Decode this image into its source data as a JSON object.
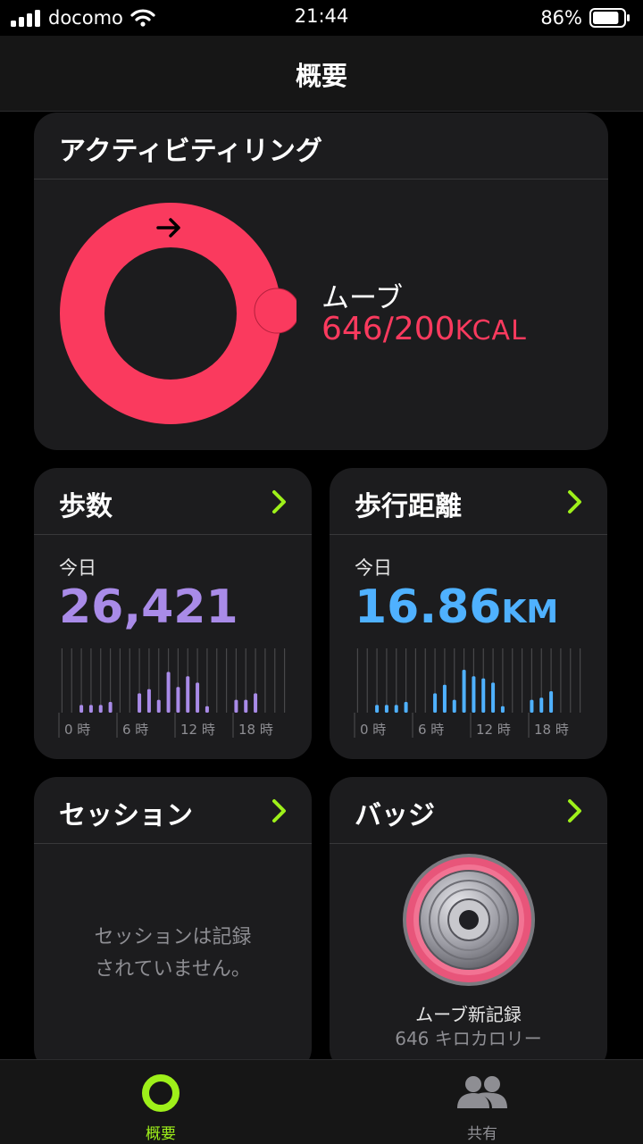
{
  "status_bar": {
    "carrier": "docomo",
    "time": "21:44",
    "battery": "86%",
    "battery_level": 0.86
  },
  "nav": {
    "title": "概要"
  },
  "activity_ring": {
    "title": "アクティビティリング",
    "label": "ムーブ",
    "value": "646/200",
    "unit": "KCAL",
    "progress": 3.23,
    "color": "#fa3a5e"
  },
  "steps": {
    "title": "歩数",
    "today_label": "今日",
    "value": "26,421",
    "unit": "",
    "color": "#a98be8",
    "hour_labels": [
      "0 時",
      "6 時",
      "12 時",
      "18 時"
    ],
    "hourly": [
      0,
      0,
      0.18,
      0.18,
      0.18,
      0.25,
      0,
      0,
      0.45,
      0.55,
      0.3,
      0.95,
      0.6,
      0.85,
      0.7,
      0.15,
      0,
      0,
      0.3,
      0.3,
      0.45,
      0,
      0,
      0
    ]
  },
  "distance": {
    "title": "歩行距離",
    "today_label": "今日",
    "value": "16.86",
    "unit": "KM",
    "color": "#4fb1ff",
    "hour_labels": [
      "0 時",
      "6 時",
      "12 時",
      "18 時"
    ],
    "hourly": [
      0,
      0,
      0.18,
      0.18,
      0.18,
      0.25,
      0,
      0,
      0.45,
      0.65,
      0.3,
      1.0,
      0.85,
      0.8,
      0.7,
      0.15,
      0,
      0,
      0.3,
      0.35,
      0.5,
      0,
      0,
      0
    ]
  },
  "sessions": {
    "title": "セッション",
    "empty_line1": "セッションは記録",
    "empty_line2": "されていません。"
  },
  "badges": {
    "title": "バッジ",
    "badge_name": "ムーブ新記録",
    "badge_detail": "646 キロカロリー"
  },
  "tabs": [
    {
      "label": "概要",
      "icon": "activity-ring-icon",
      "active": true
    },
    {
      "label": "共有",
      "icon": "people-icon",
      "active": false
    }
  ],
  "colors": {
    "accent": "#9ef01a",
    "move": "#fa3a5e",
    "card": "#1c1c1e"
  }
}
